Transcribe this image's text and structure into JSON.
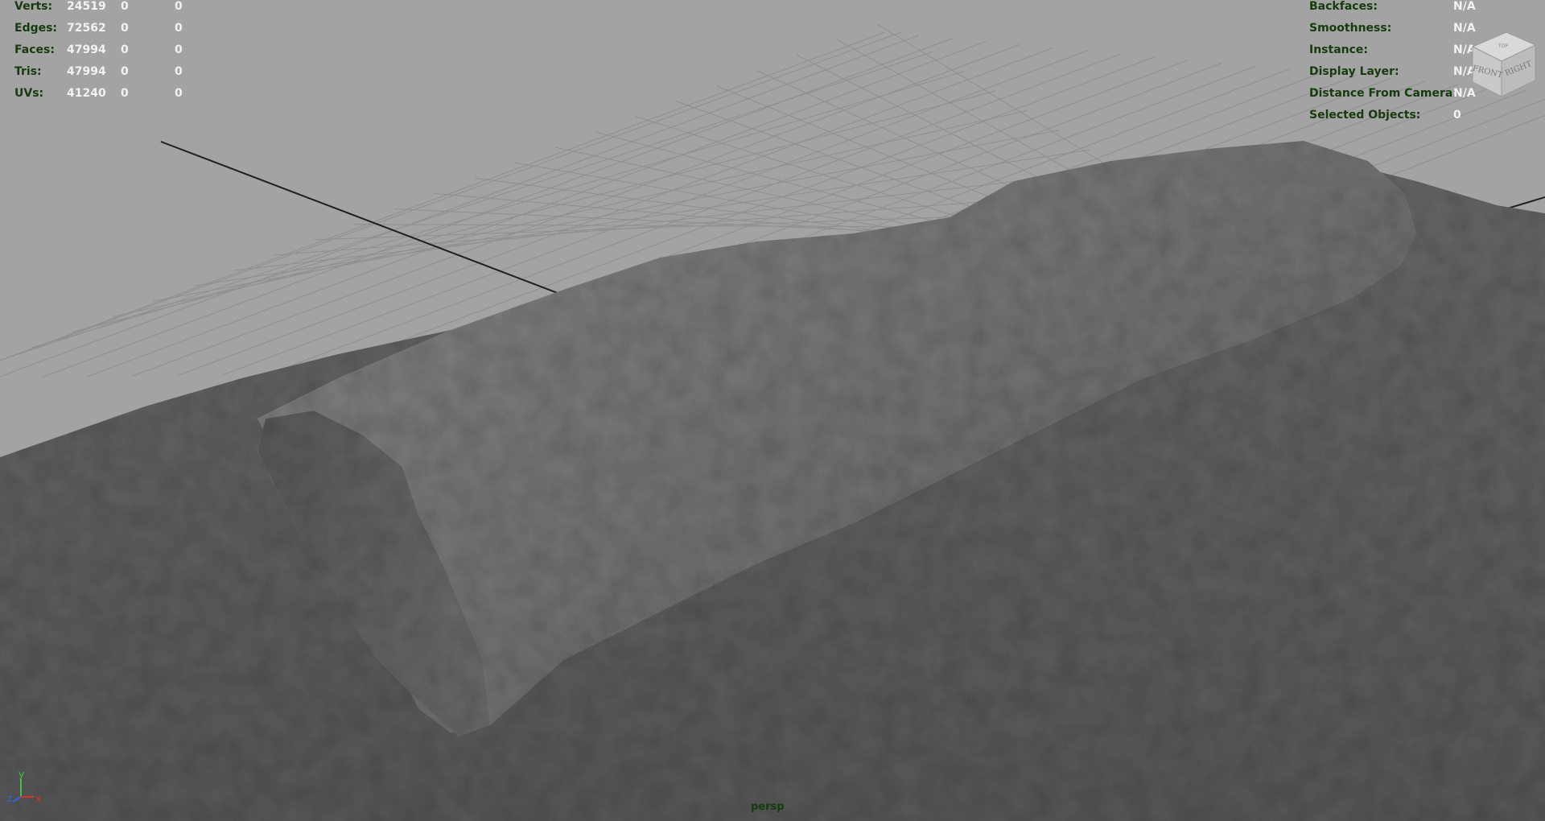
{
  "app": "Autodesk Maya viewport",
  "heads_up_display": {
    "poly_count": [
      {
        "label": "Verts:",
        "values": [
          "24519",
          "0",
          "0"
        ]
      },
      {
        "label": "Edges:",
        "values": [
          "72562",
          "0",
          "0"
        ]
      },
      {
        "label": "Faces:",
        "values": [
          "47994",
          "0",
          "0"
        ]
      },
      {
        "label": "Tris:",
        "values": [
          "47994",
          "0",
          "0"
        ]
      },
      {
        "label": "UVs:",
        "values": [
          "41240",
          "0",
          "0"
        ]
      }
    ],
    "object_details": [
      {
        "label": "Backfaces:",
        "value": "N/A"
      },
      {
        "label": "Smoothness:",
        "value": "N/A"
      },
      {
        "label": "Instance:",
        "value": "N/A"
      },
      {
        "label": "Display Layer:",
        "value": "N/A"
      },
      {
        "label": "Distance From Camera:",
        "value": "N/A"
      },
      {
        "label": "Selected Objects:",
        "value": "0"
      }
    ]
  },
  "view_cube": {
    "faces": [
      "TOP",
      "FRONT",
      "RIGHT"
    ]
  },
  "axis_gizmo": {
    "x": "x",
    "y": "y",
    "z": "z",
    "colors": {
      "x": "#d8322a",
      "y": "#3fc24a",
      "z": "#3b5fe0"
    }
  },
  "camera_name": "persp",
  "colors": {
    "background": "#a3a3a3",
    "grid": "#8f8f8f",
    "mesh": "#6f6f6f",
    "hud_label": "#163b0e",
    "hud_value": "#f2f2f2"
  }
}
